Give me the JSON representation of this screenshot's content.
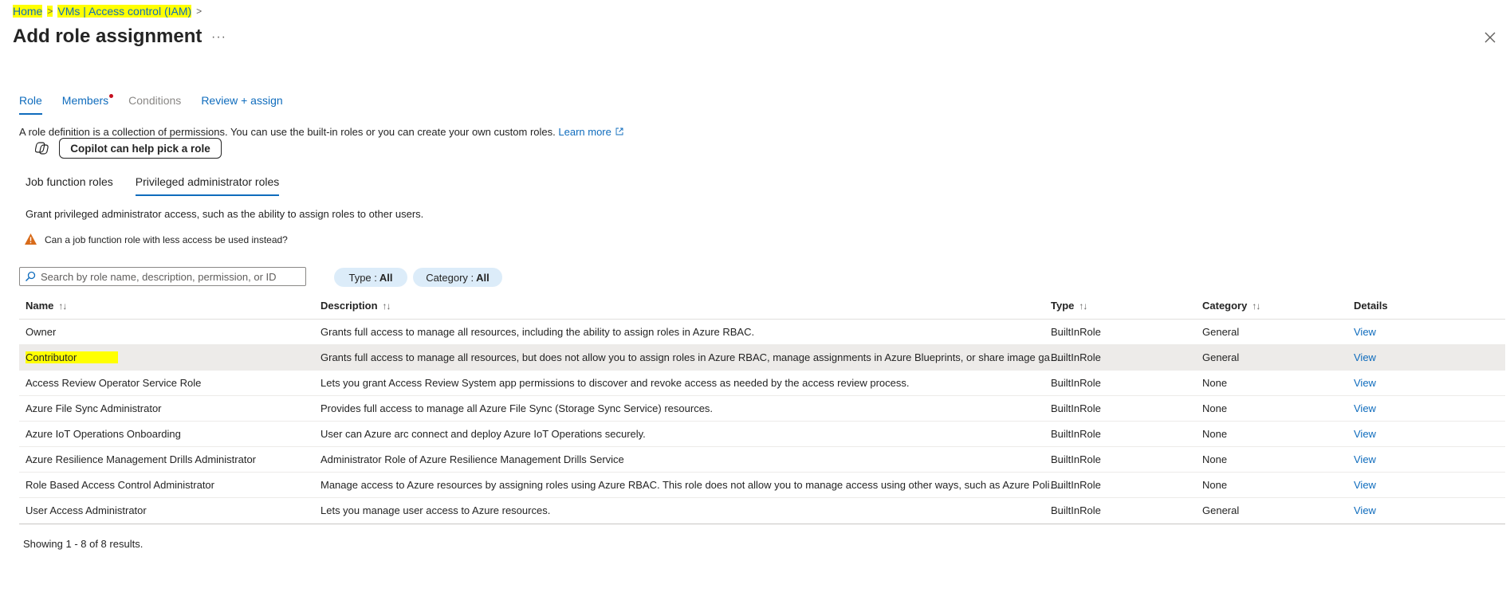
{
  "breadcrumb": {
    "home": "Home",
    "iam": "VMs | Access control (IAM)",
    "sep": ">"
  },
  "title": "Add role assignment",
  "more": "···",
  "tabs": [
    {
      "label": "Role"
    },
    {
      "label": "Members"
    },
    {
      "label": "Conditions"
    },
    {
      "label": "Review + assign"
    }
  ],
  "description": "A role definition is a collection of permissions. You can use the built-in roles or you can create your own custom roles.",
  "learn_more": "Learn more",
  "copilot_button": "Copilot can help pick a role",
  "subtabs": [
    {
      "label": "Job function roles"
    },
    {
      "label": "Privileged administrator roles"
    }
  ],
  "grant_text": "Grant privileged administrator access, such as the ability to assign roles to other users.",
  "warning_text": "Can a job function role with less access be used instead?",
  "search": {
    "placeholder": "Search by role name, description, permission, or ID"
  },
  "filters": {
    "type_label": "Type :",
    "type_value": "All",
    "category_label": "Category :",
    "category_value": "All"
  },
  "columns": {
    "name": "Name",
    "description": "Description",
    "type": "Type",
    "category": "Category",
    "details": "Details"
  },
  "rows": [
    {
      "name": "Owner",
      "description": "Grants full access to manage all resources, including the ability to assign roles in Azure RBAC.",
      "type": "BuiltInRole",
      "category": "General",
      "details": "View"
    },
    {
      "name": "Contributor",
      "description": "Grants full access to manage all resources, but does not allow you to assign roles in Azure RBAC, manage assignments in Azure Blueprints, or share image galleries.",
      "type": "BuiltInRole",
      "category": "General",
      "details": "View"
    },
    {
      "name": "Access Review Operator Service Role",
      "description": "Lets you grant Access Review System app permissions to discover and revoke access as needed by the access review process.",
      "type": "BuiltInRole",
      "category": "None",
      "details": "View"
    },
    {
      "name": "Azure File Sync Administrator",
      "description": "Provides full access to manage all Azure File Sync (Storage Sync Service) resources.",
      "type": "BuiltInRole",
      "category": "None",
      "details": "View"
    },
    {
      "name": "Azure IoT Operations Onboarding",
      "description": "User can Azure arc connect and deploy Azure IoT Operations securely.",
      "type": "BuiltInRole",
      "category": "None",
      "details": "View"
    },
    {
      "name": "Azure Resilience Management Drills Administrator",
      "description": "Administrator Role of Azure Resilience Management Drills Service",
      "type": "BuiltInRole",
      "category": "None",
      "details": "View"
    },
    {
      "name": "Role Based Access Control Administrator",
      "description": "Manage access to Azure resources by assigning roles using Azure RBAC. This role does not allow you to manage access using other ways, such as Azure Policy.",
      "type": "BuiltInRole",
      "category": "None",
      "details": "View"
    },
    {
      "name": "User Access Administrator",
      "description": "Lets you manage user access to Azure resources.",
      "type": "BuiltInRole",
      "category": "General",
      "details": "View"
    }
  ],
  "showing": "Showing 1 - 8 of 8 results.",
  "colors": {
    "accent": "#0f6cbd",
    "highlight": "#ffff00",
    "warning": "#d86b1a",
    "required_dot": "#c50f1f"
  }
}
